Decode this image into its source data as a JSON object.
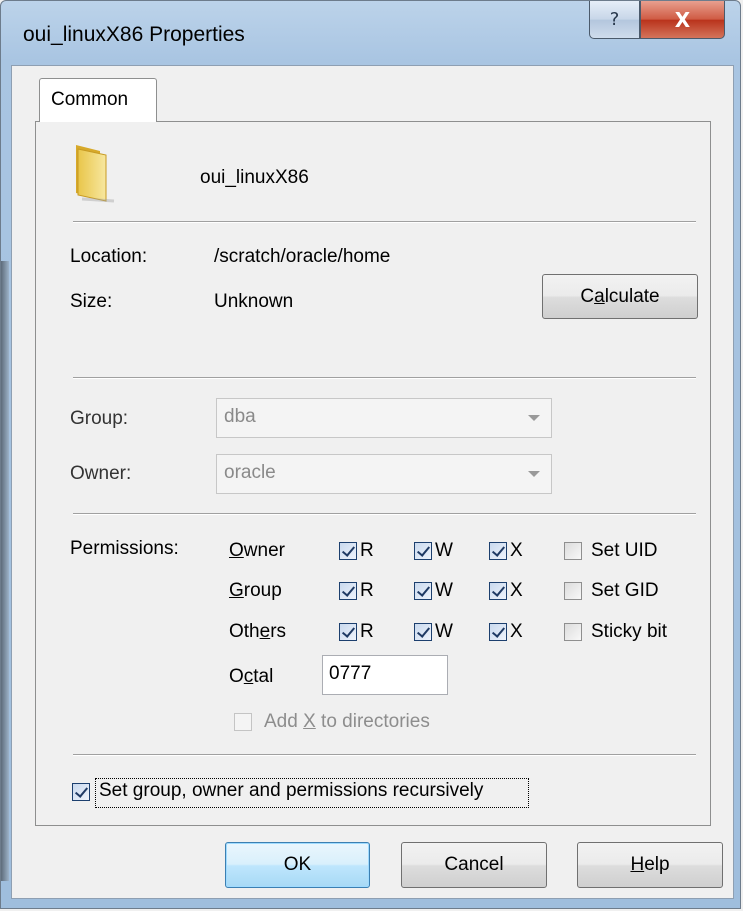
{
  "window": {
    "title": "oui_linuxX86 Properties",
    "help_glyph": "?",
    "close_glyph": "X"
  },
  "tabs": [
    {
      "label": "Common"
    }
  ],
  "item": {
    "name": "oui_linuxX86",
    "icon": "folder-icon"
  },
  "info": {
    "location_label": "Location:",
    "location_value": "/scratch/oracle/home",
    "size_label": "Size:",
    "size_value": "Unknown",
    "calculate_pre": "C",
    "calculate_mnemonic": "a",
    "calculate_post": "lculate"
  },
  "group": {
    "label": "Group:",
    "value": "dba"
  },
  "owner": {
    "label": "Owner:",
    "value": "oracle"
  },
  "permissions": {
    "label": "Permissions:",
    "rows": [
      {
        "mn": "O",
        "rest": "wner",
        "r": "R",
        "w": "W",
        "x": "X",
        "special": "Set UID"
      },
      {
        "mn": "G",
        "rest": "roup",
        "r": "R",
        "w": "W",
        "x": "X",
        "special": "Set GID"
      },
      {
        "pre": "Oth",
        "mn": "e",
        "rest": "rs",
        "r": "R",
        "w": "W",
        "x": "X",
        "special": "Sticky bit"
      }
    ],
    "octal_pre": "O",
    "octal_mn": "c",
    "octal_post": "tal",
    "octal_value": "0777",
    "add_x_pre": "Add ",
    "add_x_mn": "X",
    "add_x_post": " to directories"
  },
  "recursive_label": "Set group, owner and permissions recursively",
  "buttons": {
    "ok": "OK",
    "cancel": "Cancel",
    "help_mn": "H",
    "help_rest": "elp"
  },
  "colors": {
    "accent": "#3c7fb1",
    "close": "#c7432b",
    "title_bar": "#a9c5e2"
  }
}
